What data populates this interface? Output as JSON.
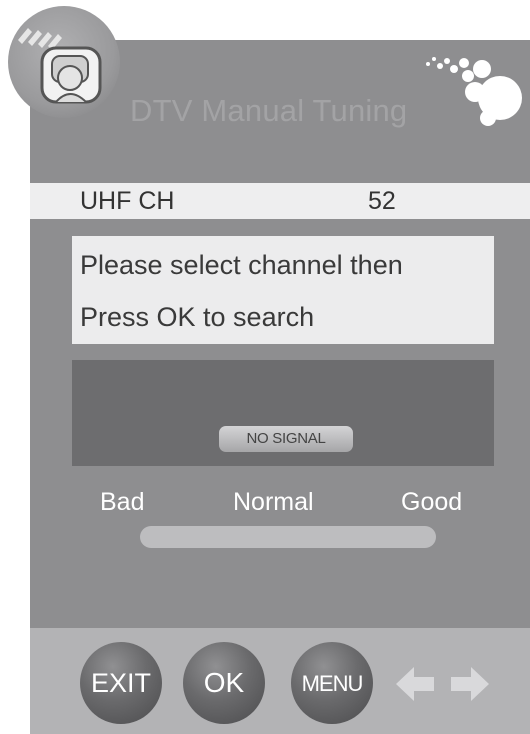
{
  "window": {
    "title": "DTV Manual Tuning"
  },
  "channel": {
    "band": "UHF  CH",
    "number": "52"
  },
  "message": {
    "line1": "Please select channel then",
    "line2": "Press OK to search"
  },
  "signal": {
    "status": "NO SIGNAL"
  },
  "quality": {
    "bad": "Bad",
    "normal": "Normal",
    "good": "Good",
    "level": 0
  },
  "buttons": {
    "exit": "EXIT",
    "ok": "OK",
    "menu": "MENU"
  },
  "icons": {
    "left": "left-arrow-icon",
    "right": "right-arrow-icon",
    "logo": "tv-mascot-icon",
    "decoration": "bubbles-icon"
  },
  "colors": {
    "panel": "#8e8e90",
    "bottom_bar": "#b3b3b5",
    "highlight_row": "#eeeeef",
    "signal_box": "#6d6d6f"
  }
}
